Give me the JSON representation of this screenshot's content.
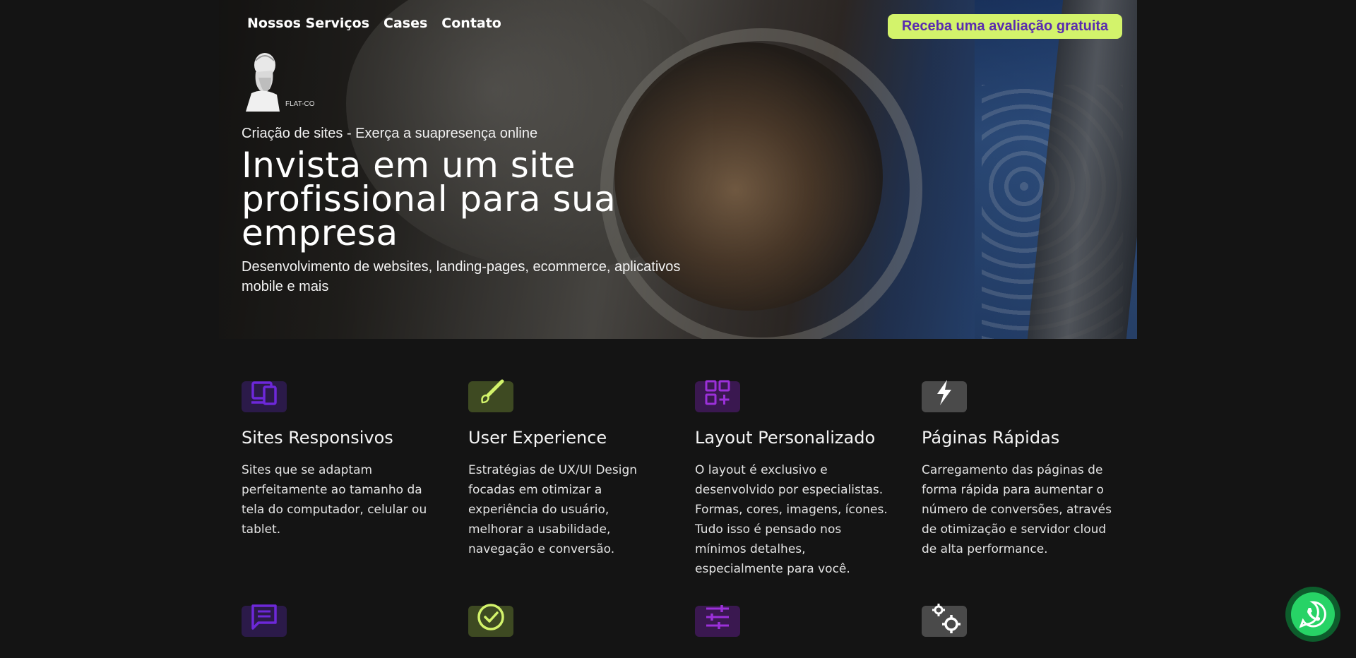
{
  "nav": {
    "items": [
      "Nossos Serviços",
      "Cases",
      "Contato"
    ]
  },
  "cta": {
    "label": "Receba uma avaliação gratuita"
  },
  "logo": {
    "text": "FLAT-CO"
  },
  "hero": {
    "kicker": "Criação de sites - Exerça a suapresença online",
    "headline": "Invista em um site profissional para sua empresa",
    "subtitle": "Desenvolvimento de websites, landing-pages, ecommerce, aplicativos mobile e mais"
  },
  "features": [
    {
      "title": "Sites Responsivos",
      "description": "Sites que se adaptam perfeitamente ao tamanho da tela do computador, celular ou tablet.",
      "icon": "devices-icon",
      "color": "#6d28d9",
      "bg": "#2b1a49"
    },
    {
      "title": "User Experience",
      "description": "Estratégias de UX/UI Design focadas em otimizar a experiência do usuário, melhorar a usabilidade, navegação e conversão.",
      "icon": "paintbrush-icon",
      "color": "#d3f36b",
      "bg": "#3e4a22"
    },
    {
      "title": "Layout Personalizado",
      "description": "O layout é exclusivo e desenvolvido por especialistas. Formas, cores, imagens, ícones. Tudo isso é pensado nos mínimos detalhes, especialmente para você.",
      "icon": "grid-plus-icon",
      "color": "#9b30d9",
      "bg": "#3a1850"
    },
    {
      "title": "Páginas Rápidas",
      "description": "Carregamento das páginas de forma rápida para aumentar o número de conversões, através de otimização e servidor cloud de alta performance.",
      "icon": "lightning-icon",
      "color": "#ffffff",
      "bg": "#4a4a4a"
    }
  ],
  "features_row2": [
    {
      "icon": "chat-icon",
      "color": "#6d28d9",
      "bg": "#2b1a49"
    },
    {
      "icon": "check-circle-icon",
      "color": "#d3f36b",
      "bg": "#3e4a22"
    },
    {
      "icon": "sliders-icon",
      "color": "#9b30d9",
      "bg": "#3a1850"
    },
    {
      "icon": "gears-icon",
      "color": "#ffffff",
      "bg": "#4a4a4a"
    }
  ],
  "whatsapp": {
    "icon": "whatsapp-icon",
    "color": "#27d366"
  }
}
